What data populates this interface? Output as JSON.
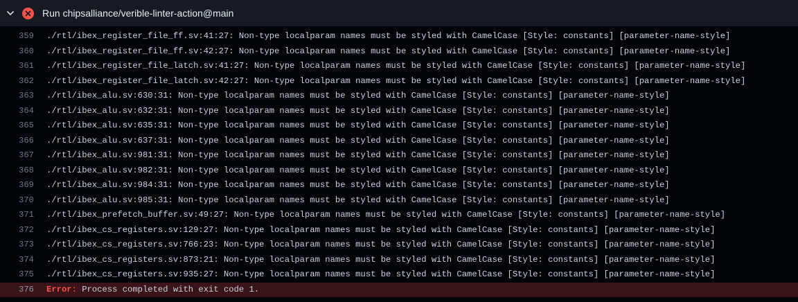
{
  "step": {
    "title": "Run chipsalliance/verible-linter-action@main",
    "status": "failed"
  },
  "colors": {
    "error": "#f85149",
    "header_bg": "#161b22",
    "body_bg": "#010409",
    "error_row_bg": "#3a1418"
  },
  "icons": {
    "chevron": "chevron-down-icon",
    "status": "x-circle-fill-icon"
  },
  "log": [
    {
      "n": "359",
      "text": "./rtl/ibex_register_file_ff.sv:41:27: Non-type localparam names must be styled with CamelCase [Style: constants] [parameter-name-style]"
    },
    {
      "n": "360",
      "text": "./rtl/ibex_register_file_ff.sv:42:27: Non-type localparam names must be styled with CamelCase [Style: constants] [parameter-name-style]"
    },
    {
      "n": "361",
      "text": "./rtl/ibex_register_file_latch.sv:41:27: Non-type localparam names must be styled with CamelCase [Style: constants] [parameter-name-style]"
    },
    {
      "n": "362",
      "text": "./rtl/ibex_register_file_latch.sv:42:27: Non-type localparam names must be styled with CamelCase [Style: constants] [parameter-name-style]"
    },
    {
      "n": "363",
      "text": "./rtl/ibex_alu.sv:630:31: Non-type localparam names must be styled with CamelCase [Style: constants] [parameter-name-style]"
    },
    {
      "n": "364",
      "text": "./rtl/ibex_alu.sv:632:31: Non-type localparam names must be styled with CamelCase [Style: constants] [parameter-name-style]"
    },
    {
      "n": "365",
      "text": "./rtl/ibex_alu.sv:635:31: Non-type localparam names must be styled with CamelCase [Style: constants] [parameter-name-style]"
    },
    {
      "n": "366",
      "text": "./rtl/ibex_alu.sv:637:31: Non-type localparam names must be styled with CamelCase [Style: constants] [parameter-name-style]"
    },
    {
      "n": "367",
      "text": "./rtl/ibex_alu.sv:981:31: Non-type localparam names must be styled with CamelCase [Style: constants] [parameter-name-style]"
    },
    {
      "n": "368",
      "text": "./rtl/ibex_alu.sv:982:31: Non-type localparam names must be styled with CamelCase [Style: constants] [parameter-name-style]"
    },
    {
      "n": "369",
      "text": "./rtl/ibex_alu.sv:984:31: Non-type localparam names must be styled with CamelCase [Style: constants] [parameter-name-style]"
    },
    {
      "n": "370",
      "text": "./rtl/ibex_alu.sv:985:31: Non-type localparam names must be styled with CamelCase [Style: constants] [parameter-name-style]"
    },
    {
      "n": "371",
      "text": "./rtl/ibex_prefetch_buffer.sv:49:27: Non-type localparam names must be styled with CamelCase [Style: constants] [parameter-name-style]"
    },
    {
      "n": "372",
      "text": "./rtl/ibex_cs_registers.sv:129:27: Non-type localparam names must be styled with CamelCase [Style: constants] [parameter-name-style]"
    },
    {
      "n": "373",
      "text": "./rtl/ibex_cs_registers.sv:766:23: Non-type localparam names must be styled with CamelCase [Style: constants] [parameter-name-style]"
    },
    {
      "n": "374",
      "text": "./rtl/ibex_cs_registers.sv:873:21: Non-type localparam names must be styled with CamelCase [Style: constants] [parameter-name-style]"
    },
    {
      "n": "375",
      "text": "./rtl/ibex_cs_registers.sv:935:27: Non-type localparam names must be styled with CamelCase [Style: constants] [parameter-name-style]"
    }
  ],
  "error_line": {
    "n": "376",
    "label": "Error:",
    "text": " Process completed with exit code 1."
  }
}
